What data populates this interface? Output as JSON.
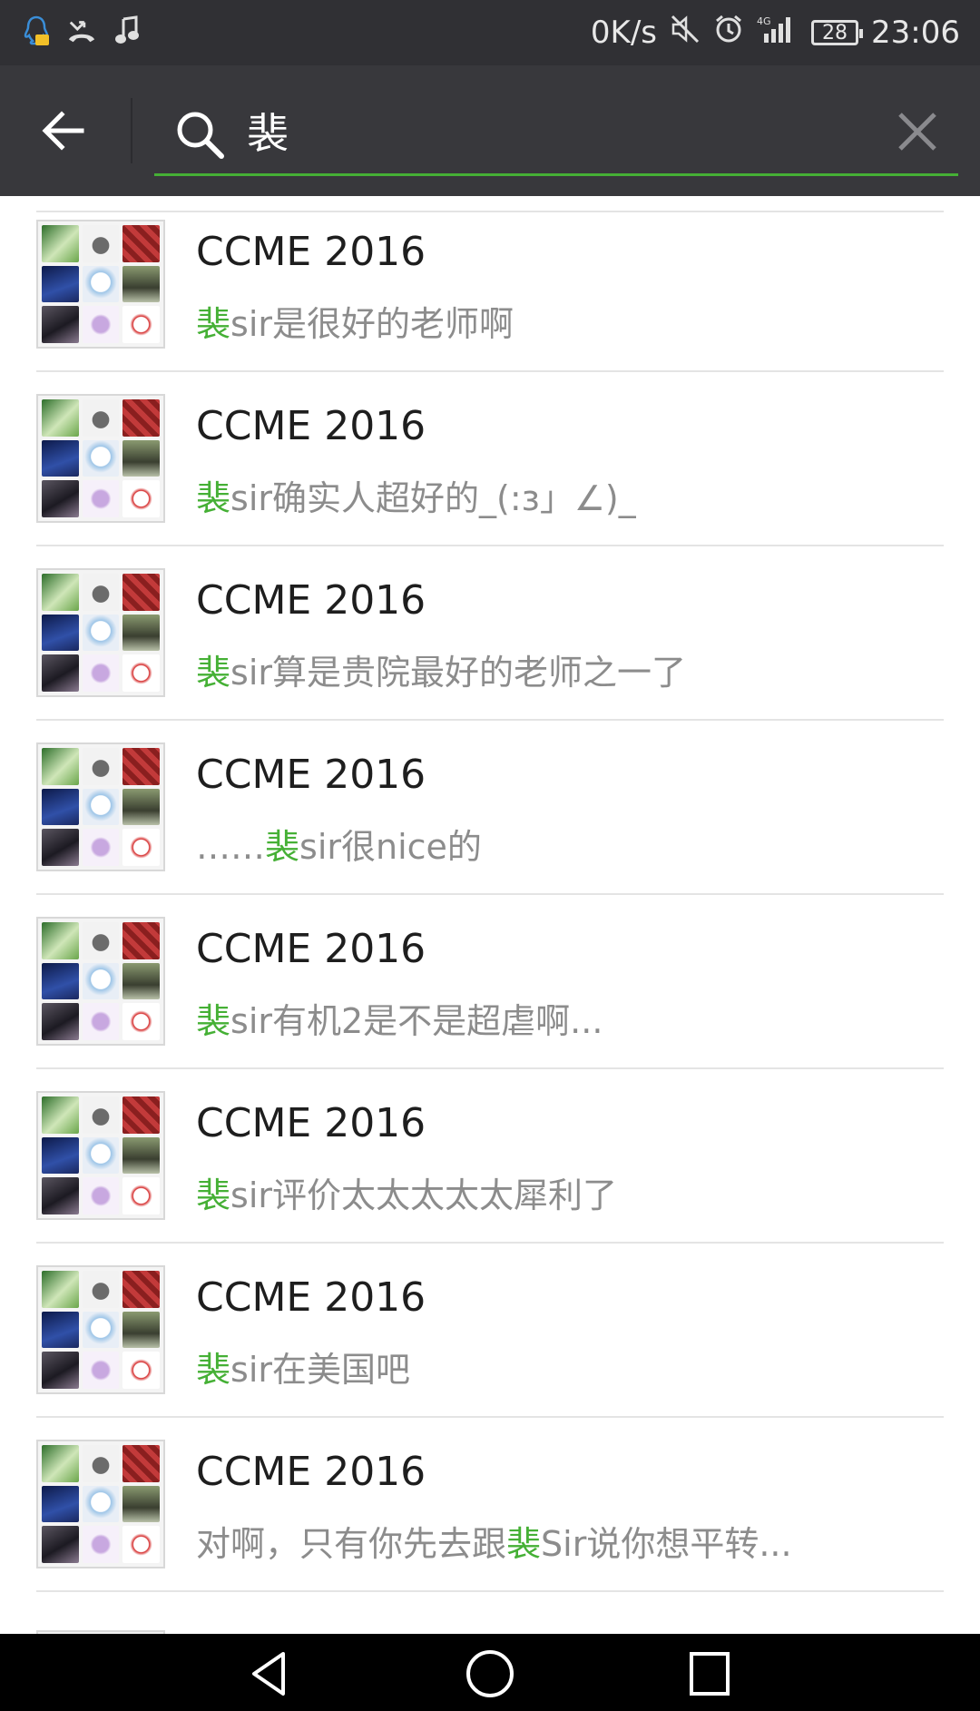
{
  "status_bar": {
    "speed": "0K/s",
    "battery": "28",
    "time": "23:06",
    "network": "4G"
  },
  "search": {
    "query": "裴",
    "accent_color": "#45b035"
  },
  "results": [
    {
      "title": "CCME 2016",
      "pre": "",
      "hl": "裴",
      "post": "sir是很好的老师啊"
    },
    {
      "title": "CCME 2016",
      "pre": "",
      "hl": "裴",
      "post": "sir确实人超好的_(:з」∠)_"
    },
    {
      "title": "CCME 2016",
      "pre": "",
      "hl": "裴",
      "post": "sir算是贵院最好的老师之一了"
    },
    {
      "title": "CCME 2016",
      "pre": "……",
      "hl": "裴",
      "post": "sir很nice的"
    },
    {
      "title": "CCME 2016",
      "pre": "",
      "hl": "裴",
      "post": "sir有机2是不是超虐啊..."
    },
    {
      "title": "CCME 2016",
      "pre": "",
      "hl": "裴",
      "post": "sir评价太太太太太犀利了"
    },
    {
      "title": "CCME 2016",
      "pre": "",
      "hl": "裴",
      "post": "sir在美国吧"
    },
    {
      "title": "CCME 2016",
      "pre": "对啊，只有你先去跟",
      "hl": "裴",
      "post": "Sir说你想平转..."
    }
  ],
  "icons": {
    "back": "arrow-left-icon",
    "search": "search-icon",
    "clear": "close-icon",
    "nav": [
      "back-triangle-icon",
      "home-circle-icon",
      "recents-square-icon"
    ]
  }
}
